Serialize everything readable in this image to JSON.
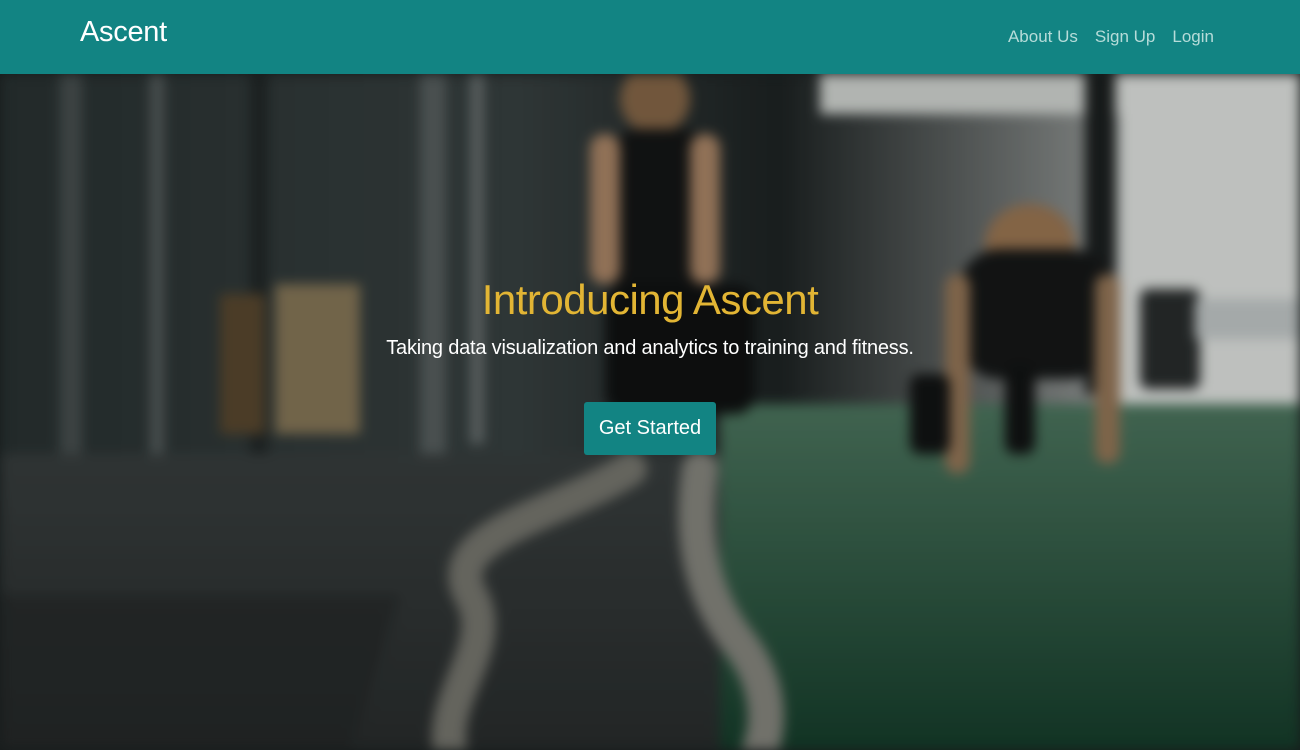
{
  "navbar": {
    "brand": "Ascent",
    "links": [
      {
        "label": "About Us"
      },
      {
        "label": "Sign Up"
      },
      {
        "label": "Login"
      }
    ]
  },
  "hero": {
    "title": "Introducing Ascent",
    "subtitle": "Taking data visualization and analytics to training and fitness.",
    "cta_label": "Get Started",
    "background_description": "blurred gym photo with battle ropes on floor and athletes exercising on green turf"
  },
  "colors": {
    "navbar": "#128483",
    "title": "#e2b534",
    "button": "#128483"
  }
}
